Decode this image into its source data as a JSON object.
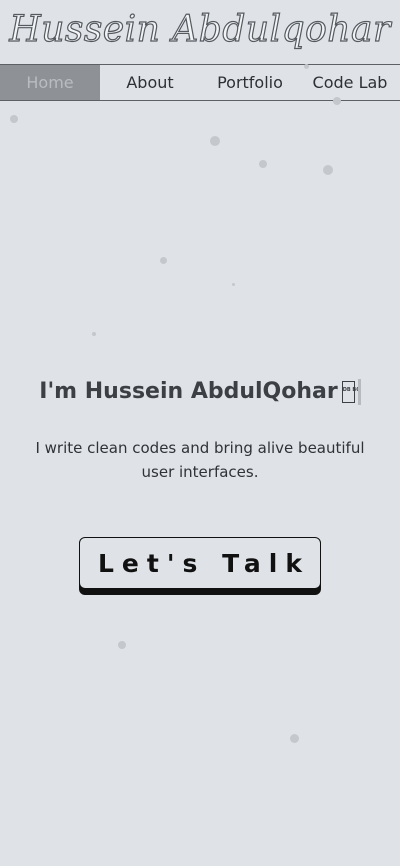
{
  "header": {
    "logo_text": "Hussein Abdulqohar"
  },
  "nav": {
    "items": [
      {
        "label": "Home",
        "active": true
      },
      {
        "label": "About",
        "active": false
      },
      {
        "label": "Portfolio",
        "active": false
      },
      {
        "label": "Code Lab",
        "active": false
      }
    ]
  },
  "hero": {
    "title": "I'm Hussein AbdulQohar",
    "glyph_text": "DB BC",
    "subtitle": "I write clean codes and bring alive beautiful user interfaces."
  },
  "cta": {
    "label": "Let's Talk"
  },
  "colors": {
    "background": "#dfe3e7",
    "nav_active_bg": "#8e9296",
    "text_dark": "#2d3035",
    "button_border": "#111111"
  }
}
